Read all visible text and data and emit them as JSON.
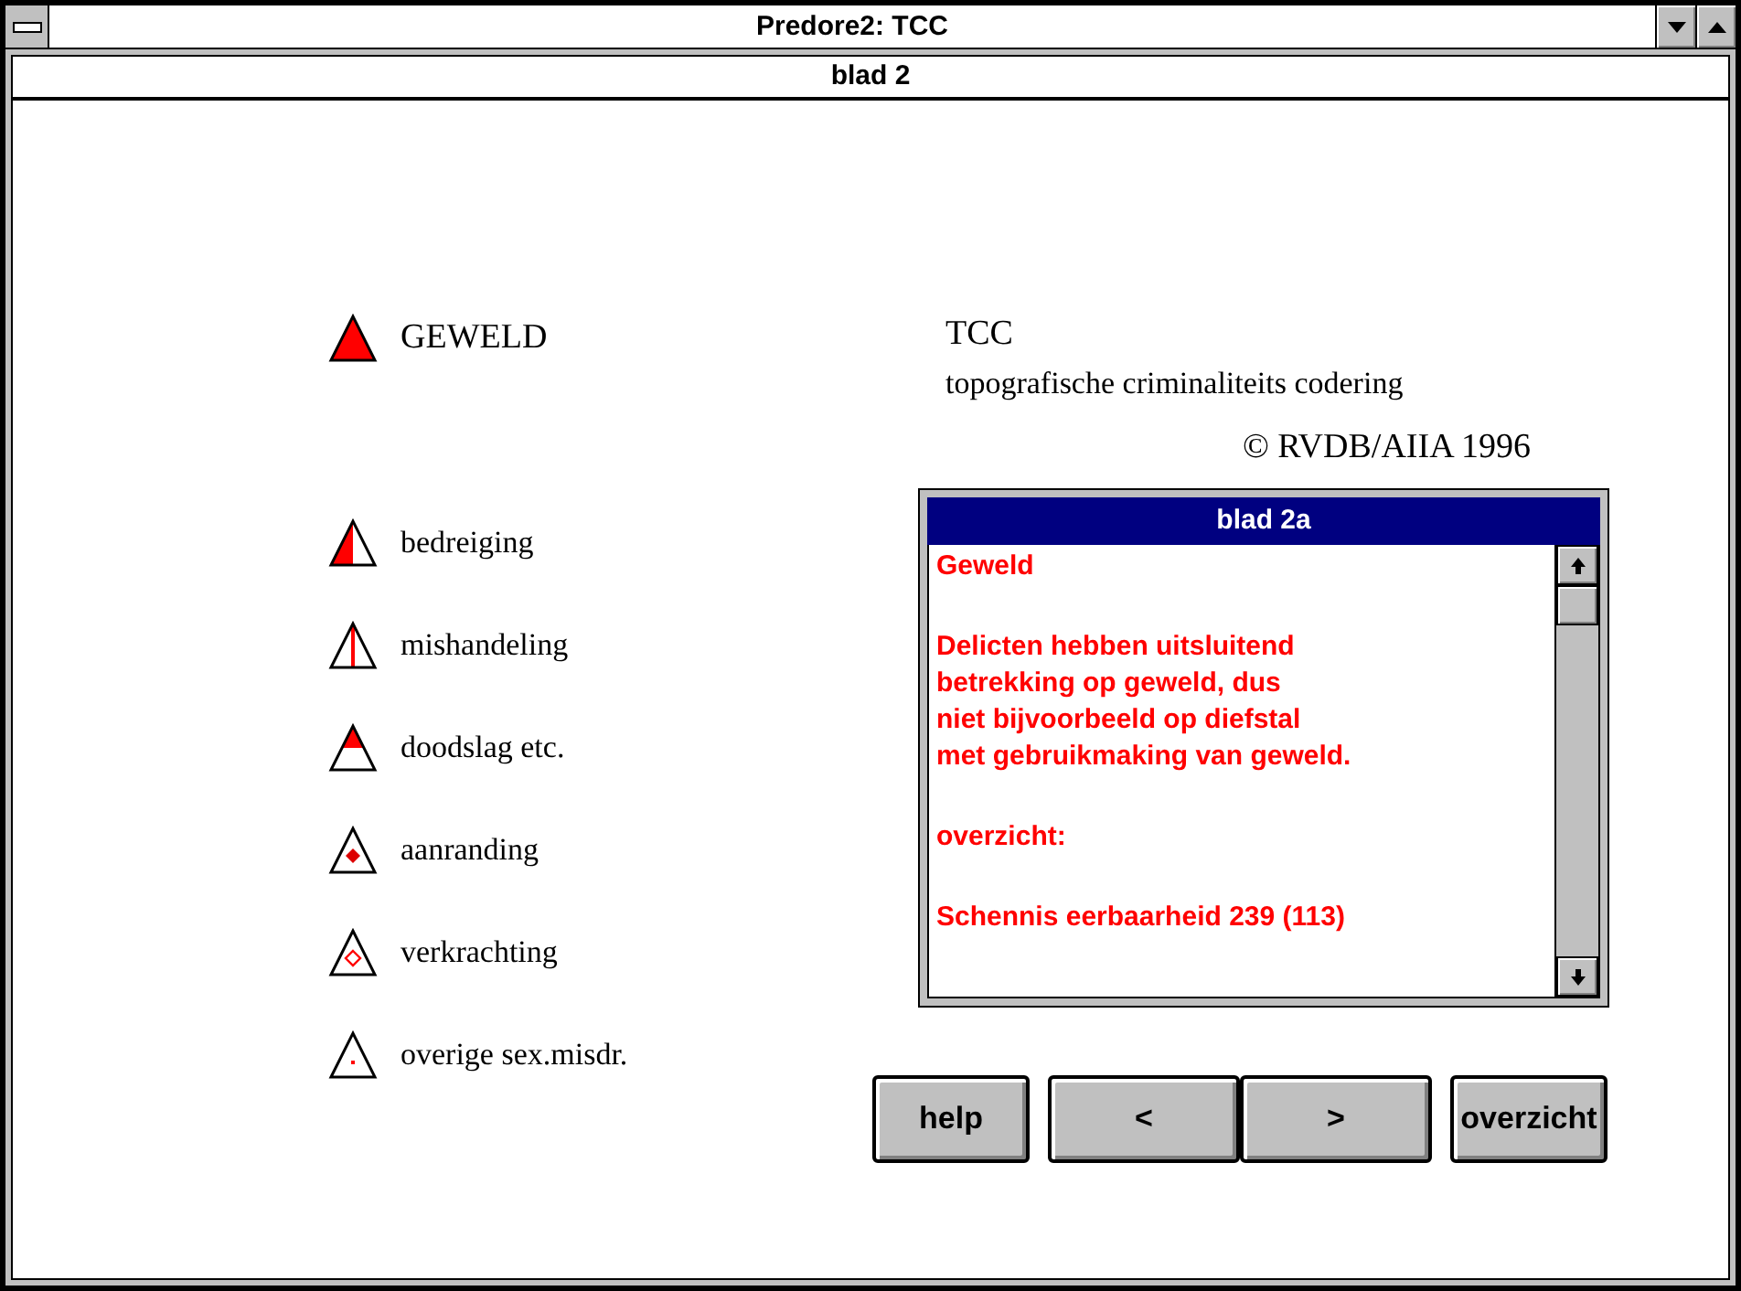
{
  "window": {
    "title": "Predore2: TCC"
  },
  "document": {
    "title": "blad 2"
  },
  "legend": {
    "heading": {
      "label": "GEWELD",
      "kind": "full"
    },
    "items": [
      {
        "label": "bedreiging",
        "kind": "half"
      },
      {
        "label": "mishandeling",
        "kind": "line"
      },
      {
        "label": "doodslag etc.",
        "kind": "top"
      },
      {
        "label": "aanranding",
        "kind": "dot"
      },
      {
        "label": "verkrachting",
        "kind": "ring"
      },
      {
        "label": "overige sex.misdr.",
        "kind": "point"
      }
    ]
  },
  "info": {
    "title": "TCC",
    "subtitle": "topografische criminaliteits codering",
    "copyright": "© RVDB/AIIA 1996"
  },
  "textbox": {
    "title": "blad 2a",
    "paragraphs": [
      [
        "Geweld"
      ],
      [
        "Delicten hebben uitsluitend",
        "betrekking op geweld, dus",
        "niet bijvoorbeeld op diefstal",
        "met gebruikmaking van geweld."
      ],
      [
        "overzicht:"
      ],
      [
        "Schennis eerbaarheid 239 (113)"
      ]
    ]
  },
  "buttons": [
    {
      "label": "help",
      "kind": "single"
    },
    {
      "label": "<",
      "kind": "pair"
    },
    {
      "label": ">",
      "kind": "pair"
    },
    {
      "label": "overzicht",
      "kind": "single"
    }
  ]
}
